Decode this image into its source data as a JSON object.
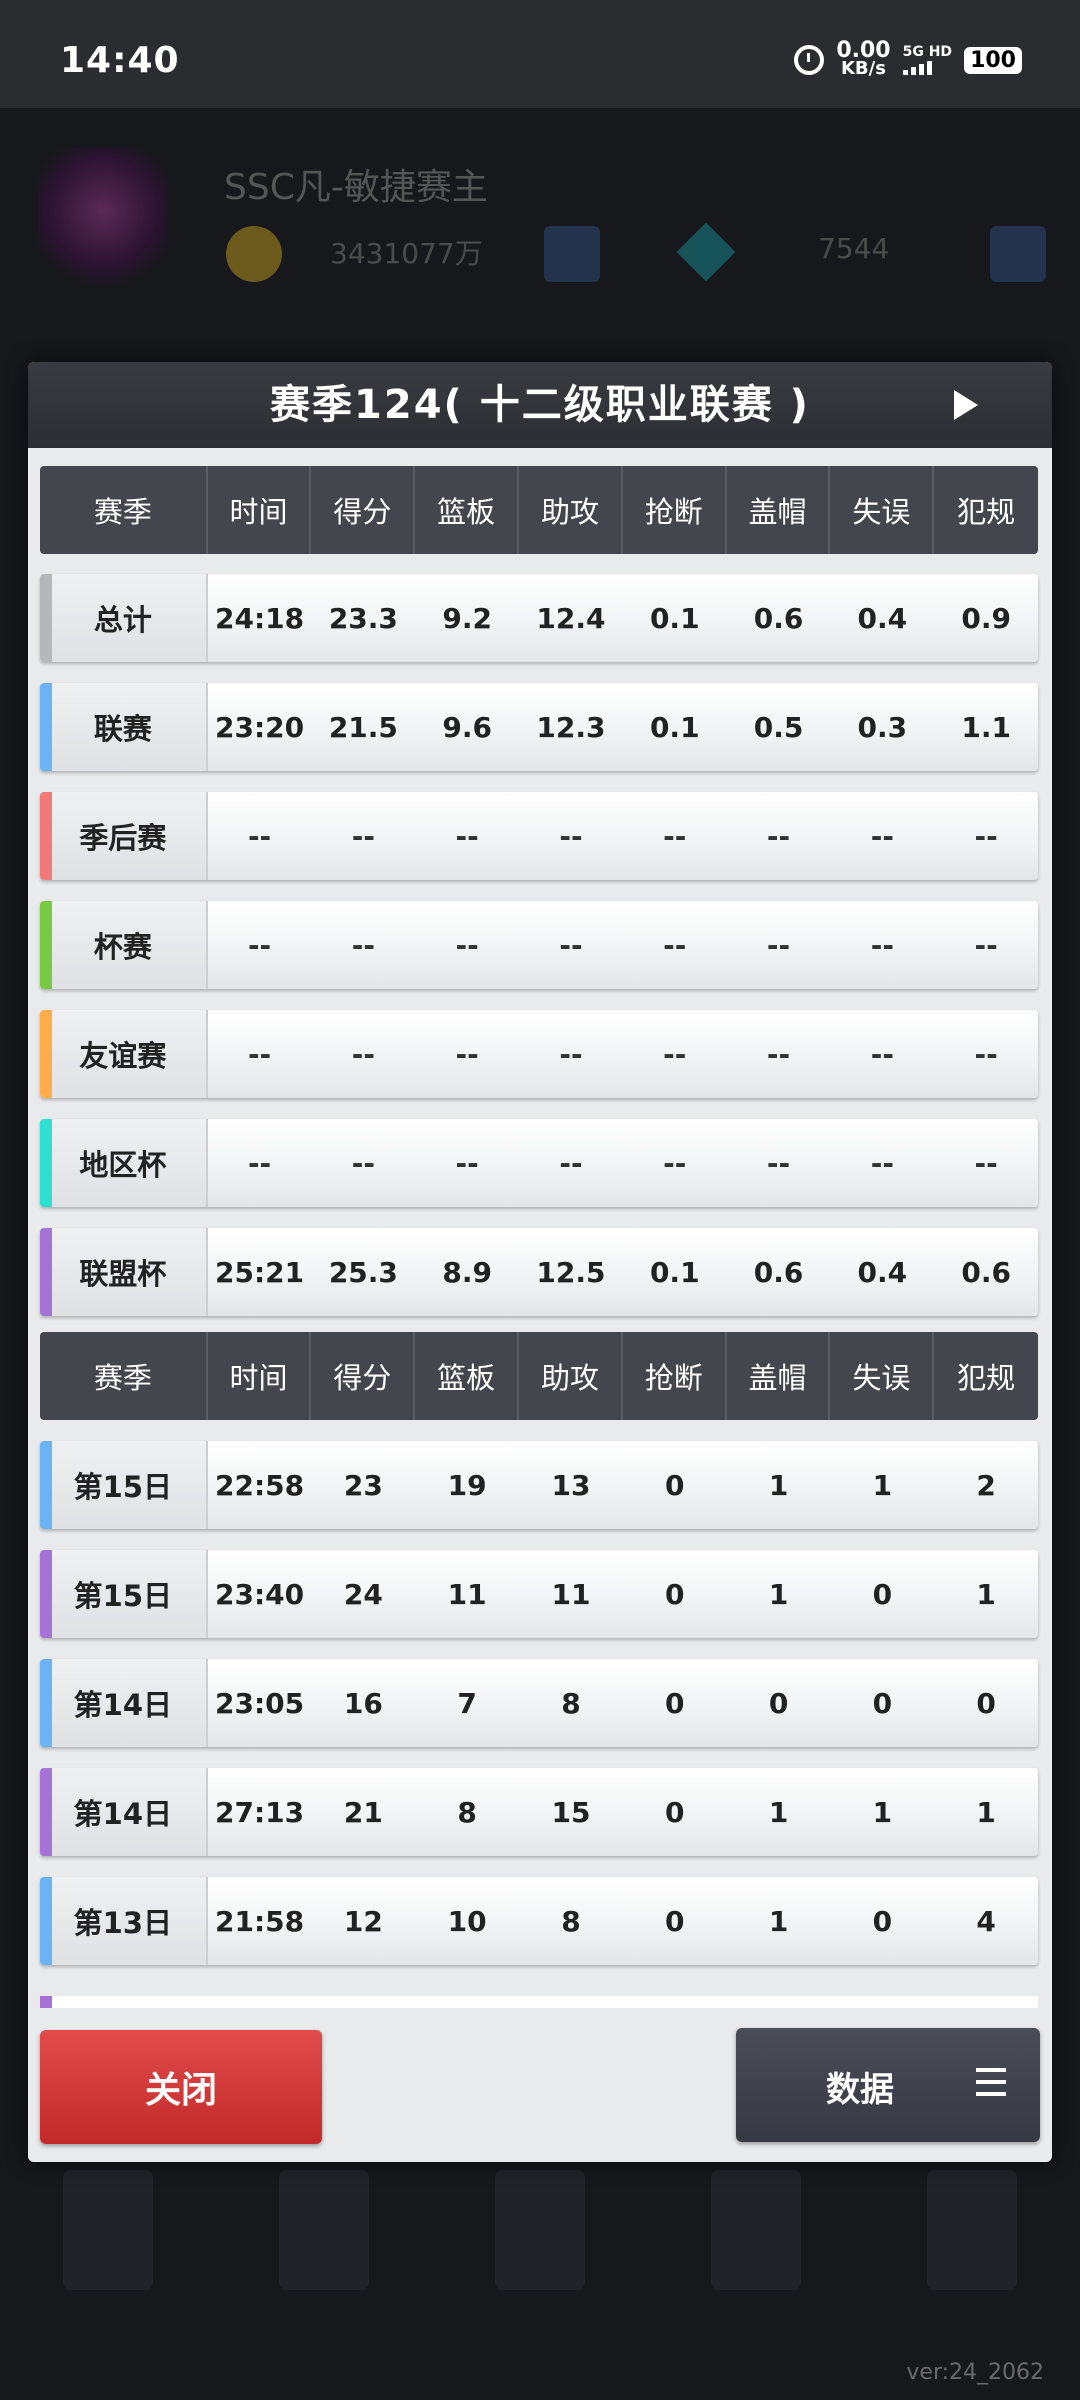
{
  "status_bar": {
    "time": "14:40",
    "net_speed": "0.00",
    "net_unit": "KB/s",
    "signal_label": "5G HD",
    "battery": "100"
  },
  "background": {
    "player_name": "SSC凡-敏捷赛主",
    "coins": "3431077万",
    "gems": "7544",
    "version": "ver:24_2062"
  },
  "modal": {
    "title": "赛季124( 十二级职业联赛 )",
    "summary_header": [
      "赛季",
      "时间",
      "得分",
      "篮板",
      "助攻",
      "抢断",
      "盖帽",
      "失误",
      "犯规"
    ],
    "summary_rows": [
      {
        "label": "总计",
        "color": "#b5b7bb",
        "values": [
          "24:18",
          "23.3",
          "9.2",
          "12.4",
          "0.1",
          "0.6",
          "0.4",
          "0.9"
        ]
      },
      {
        "label": "联赛",
        "color": "#6ab4f5",
        "values": [
          "23:20",
          "21.5",
          "9.6",
          "12.3",
          "0.1",
          "0.5",
          "0.3",
          "1.1"
        ]
      },
      {
        "label": "季后赛",
        "color": "#f07a7a",
        "values": [
          "--",
          "--",
          "--",
          "--",
          "--",
          "--",
          "--",
          "--"
        ]
      },
      {
        "label": "杯赛",
        "color": "#7ac943",
        "values": [
          "--",
          "--",
          "--",
          "--",
          "--",
          "--",
          "--",
          "--"
        ]
      },
      {
        "label": "友谊赛",
        "color": "#ffad4a",
        "values": [
          "--",
          "--",
          "--",
          "--",
          "--",
          "--",
          "--",
          "--"
        ]
      },
      {
        "label": "地区杯",
        "color": "#2ee0d0",
        "values": [
          "--",
          "--",
          "--",
          "--",
          "--",
          "--",
          "--",
          "--"
        ]
      },
      {
        "label": "联盟杯",
        "color": "#a672d8",
        "values": [
          "25:21",
          "25.3",
          "8.9",
          "12.5",
          "0.1",
          "0.6",
          "0.4",
          "0.6"
        ]
      }
    ],
    "games_header": [
      "赛季",
      "时间",
      "得分",
      "篮板",
      "助攻",
      "抢断",
      "盖帽",
      "失误",
      "犯规"
    ],
    "game_rows": [
      {
        "label": "第15日",
        "color": "#6ab4f5",
        "values": [
          "22:58",
          "23",
          "19",
          "13",
          "0",
          "1",
          "1",
          "2"
        ]
      },
      {
        "label": "第15日",
        "color": "#a672d8",
        "values": [
          "23:40",
          "24",
          "11",
          "11",
          "0",
          "1",
          "0",
          "1"
        ]
      },
      {
        "label": "第14日",
        "color": "#6ab4f5",
        "values": [
          "23:05",
          "16",
          "7",
          "8",
          "0",
          "0",
          "0",
          "0"
        ]
      },
      {
        "label": "第14日",
        "color": "#a672d8",
        "values": [
          "27:13",
          "21",
          "8",
          "15",
          "0",
          "1",
          "1",
          "1"
        ]
      },
      {
        "label": "第13日",
        "color": "#6ab4f5",
        "values": [
          "21:58",
          "12",
          "10",
          "8",
          "0",
          "1",
          "0",
          "4"
        ]
      }
    ],
    "close_label": "关闭",
    "data_label": "数据"
  }
}
